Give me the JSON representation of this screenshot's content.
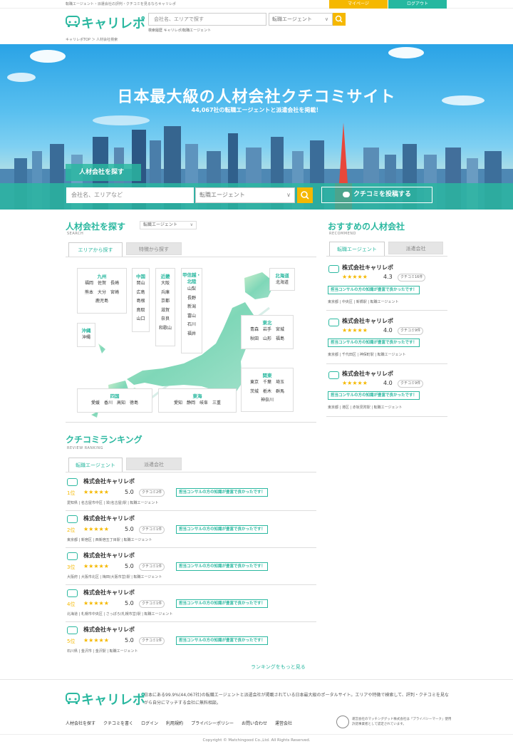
{
  "topbar": {
    "tagline": "転職エージェント・派遣会社の評判・クチコミを見るならキャリレポ",
    "mypage": "マイページ",
    "logout": "ログアウト"
  },
  "header": {
    "logo": "キャリレポ",
    "search_placeholder": "会社名、エリアで探す",
    "select_value": "転職エージェント",
    "history": "検索履歴 キャリレポ/転職エージェント"
  },
  "breadcrumb": "キャリレポTOP ＞ 人材会社検索",
  "hero": {
    "title": "日本最大級の人材会社クチコミサイト",
    "subtitle": "44,067社の転職エージェントと派遣会社を掲載！",
    "tab": "人材会社を探す",
    "input_placeholder": "会社名、エリアなど",
    "select_value": "転職エージェント",
    "post_button": "クチコミを投稿する"
  },
  "search": {
    "title": "人材会社を探す",
    "title_en": "SEARCH",
    "select_value": "転職エージェント",
    "tab_area": "エリアから探す",
    "tab_feature": "特徴から探す"
  },
  "regions": [
    {
      "name": "九州",
      "cities": [
        "福岡　佐賀　長崎",
        "熊本　大分　宮崎",
        "鹿児島"
      ]
    },
    {
      "name": "中国",
      "cities": [
        "岡山",
        "広島",
        "島根",
        "鳥取",
        "山口"
      ]
    },
    {
      "name": "近畿",
      "cities": [
        "大阪",
        "兵庫",
        "京都",
        "滋賀",
        "奈良",
        "和歌山"
      ]
    },
    {
      "name": "甲信越・北陸",
      "cities": [
        "山梨",
        "長野",
        "新潟",
        "富山",
        "石川",
        "福井"
      ]
    },
    {
      "name": "北海道",
      "cities": [
        "北海道"
      ]
    },
    {
      "name": "東北",
      "cities": [
        "青森　岩手　宮城",
        "秋田　山形　福島"
      ]
    },
    {
      "name": "沖縄",
      "cities": [
        "沖縄"
      ]
    },
    {
      "name": "関東",
      "cities": [
        "東京　千葉　埼玉",
        "茨城　栃木　群馬",
        "神奈川"
      ]
    },
    {
      "name": "四国",
      "cities": [
        "愛媛　香川　高知　徳島"
      ]
    },
    {
      "name": "東海",
      "cities": [
        "愛知　静岡　岐阜　三重"
      ]
    }
  ],
  "recommend": {
    "title": "おすすめの人材会社",
    "title_en": "RECOMMEND",
    "tab_agent": "転職エージェント",
    "tab_dispatch": "派遣会社",
    "items": [
      {
        "name": "株式会社キャリレポ",
        "stars": "★★★★★",
        "score": "4.3",
        "reviews": "クチコミ16件",
        "comment": "担当コンサルの方の知識が豊富で良かったです！",
        "meta": "東京都 | 中央区 | 新橋駅 | 転職エージェント"
      },
      {
        "name": "株式会社キャリレポ",
        "stars": "★★★★★",
        "score": "4.0",
        "reviews": "クチコミ9件",
        "comment": "担当コンサルの方の知識が豊富で良かったです！",
        "meta": "東京都 | 千代田区 | 神保町駅 | 転職エージェント"
      },
      {
        "name": "株式会社キャリレポ",
        "stars": "★★★★★",
        "score": "4.0",
        "reviews": "クチコミ9件",
        "comment": "担当コンサルの方の知識が豊富で良かったです！",
        "meta": "東京都 | 港区 | 赤坂見附駅 | 転職エージェント"
      }
    ]
  },
  "ranking": {
    "title": "クチコミランキング",
    "title_en": "REVIEW RANKING",
    "tab_agent": "転職エージェント",
    "tab_dispatch": "派遣会社",
    "more": "ランキングをもっと見る",
    "items": [
      {
        "rank": "1位",
        "name": "株式会社キャリレポ",
        "stars": "★★★★★",
        "score": "5.0",
        "reviews": "クチコミ2件",
        "comment": "担当コンサルの方の知識が豊富で良かったです！",
        "meta": "愛知県 | 名古屋市中区 | 栄(名古屋)駅 | 転職エージェント"
      },
      {
        "rank": "2位",
        "name": "株式会社キャリレポ",
        "stars": "★★★★★",
        "score": "5.0",
        "reviews": "クチコミ1件",
        "comment": "担当コンサルの方の知識が豊富で良かったです！",
        "meta": "東京都 | 新宿区 | 西新宿五丁目駅 | 転職エージェント"
      },
      {
        "rank": "3位",
        "name": "株式会社キャリレポ",
        "stars": "★★★★★",
        "score": "5.0",
        "reviews": "クチコミ1件",
        "comment": "担当コンサルの方の知識が豊富で良かったです！",
        "meta": "大阪府 | 大阪市北区 | 梅田(大阪市営)駅 | 転職エージェント"
      },
      {
        "rank": "4位",
        "name": "株式会社キャリレポ",
        "stars": "★★★★★",
        "score": "5.0",
        "reviews": "クチコミ1件",
        "comment": "担当コンサルの方の知識が豊富で良かったです！",
        "meta": "北海道 | 札幌市中央区 | さっぽろ(札幌市営)駅 | 転職エージェント"
      },
      {
        "rank": "5位",
        "name": "株式会社キャリレポ",
        "stars": "★★★★★",
        "score": "5.0",
        "reviews": "クチコミ1件",
        "comment": "担当コンサルの方の知識が豊富で良かったです！",
        "meta": "石川県 | 金沢市 | 金沢駅 | 転職エージェント"
      }
    ]
  },
  "footer": {
    "logo": "キャリレポ",
    "description": "日本にある99.9%(44,067社)の転職エージェントと派遣会社が掲載されている日本最大級のポータルサイト。エリアや特徴で検索して、評判・クチコミを見ながら自分にマッチする会社に無料相談。",
    "nav": [
      "人材会社を探す",
      "クチコミを書く",
      "ログイン",
      "利用規約",
      "プライバシーポリシー",
      "お問い合わせ",
      "運営会社"
    ],
    "privacy_text": "運営会社のマッチンググッド株式会社は「プライバシーマーク」使用許諾事業者として認定されています。",
    "copyright": "Copyright © Matchingood Co.,Ltd. All Rights Reserved."
  },
  "colors": {
    "accent": "#2bb8a0",
    "yellow": "#f5b800"
  }
}
